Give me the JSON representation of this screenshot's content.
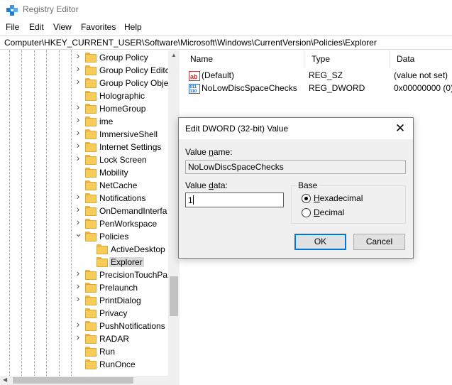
{
  "window": {
    "title": "Registry Editor"
  },
  "menu": [
    "File",
    "Edit",
    "View",
    "Favorites",
    "Help"
  ],
  "address": {
    "path": "Computer\\HKEY_CURRENT_USER\\Software\\Microsoft\\Windows\\CurrentVersion\\Policies\\Explorer"
  },
  "tree": {
    "items": [
      {
        "label": "Group Policy",
        "expander": ">"
      },
      {
        "label": "Group Policy Editc",
        "expander": ">"
      },
      {
        "label": "Group Policy Obje",
        "expander": ">"
      },
      {
        "label": "Holographic",
        "expander": ""
      },
      {
        "label": "HomeGroup",
        "expander": ">"
      },
      {
        "label": "ime",
        "expander": ">"
      },
      {
        "label": "ImmersiveShell",
        "expander": ">"
      },
      {
        "label": "Internet Settings",
        "expander": ">"
      },
      {
        "label": "Lock Screen",
        "expander": ">"
      },
      {
        "label": "Mobility",
        "expander": ""
      },
      {
        "label": "NetCache",
        "expander": ""
      },
      {
        "label": "Notifications",
        "expander": ">"
      },
      {
        "label": "OnDemandInterfa",
        "expander": ">"
      },
      {
        "label": "PenWorkspace",
        "expander": ">"
      },
      {
        "label": "Policies",
        "expander": "v"
      },
      {
        "label": "ActiveDesktop",
        "expander": "",
        "child": true
      },
      {
        "label": "Explorer",
        "expander": "",
        "child": true,
        "selected": true
      },
      {
        "label": "PrecisionTouchPa",
        "expander": ">"
      },
      {
        "label": "Prelaunch",
        "expander": ">"
      },
      {
        "label": "PrintDialog",
        "expander": ">"
      },
      {
        "label": "Privacy",
        "expander": ""
      },
      {
        "label": "PushNotifications",
        "expander": ">"
      },
      {
        "label": "RADAR",
        "expander": ">"
      },
      {
        "label": "Run",
        "expander": ""
      },
      {
        "label": "RunOnce",
        "expander": ""
      }
    ]
  },
  "list": {
    "columns": [
      "Name",
      "Type",
      "Data"
    ],
    "rows": [
      {
        "icon": "string-value-icon",
        "icon_text": "ab",
        "name": "(Default)",
        "type": "REG_SZ",
        "data": "(value not set)"
      },
      {
        "icon": "dword-value-icon",
        "icon_text": "011",
        "name": "NoLowDiscSpaceChecks",
        "type": "REG_DWORD",
        "data": "0x00000000 (0)"
      }
    ]
  },
  "dialog": {
    "title": "Edit DWORD (32-bit) Value",
    "close_glyph": "✕",
    "value_name_label": "Value name:",
    "value_name": "NoLowDiscSpaceChecks",
    "value_data_label": "Value data:",
    "value_data": "1",
    "base_label": "Base",
    "hex_label": "Hexadecimal",
    "dec_label": "Decimal",
    "base_selected": "Hexadecimal",
    "ok_label": "OK",
    "cancel_label": "Cancel"
  }
}
